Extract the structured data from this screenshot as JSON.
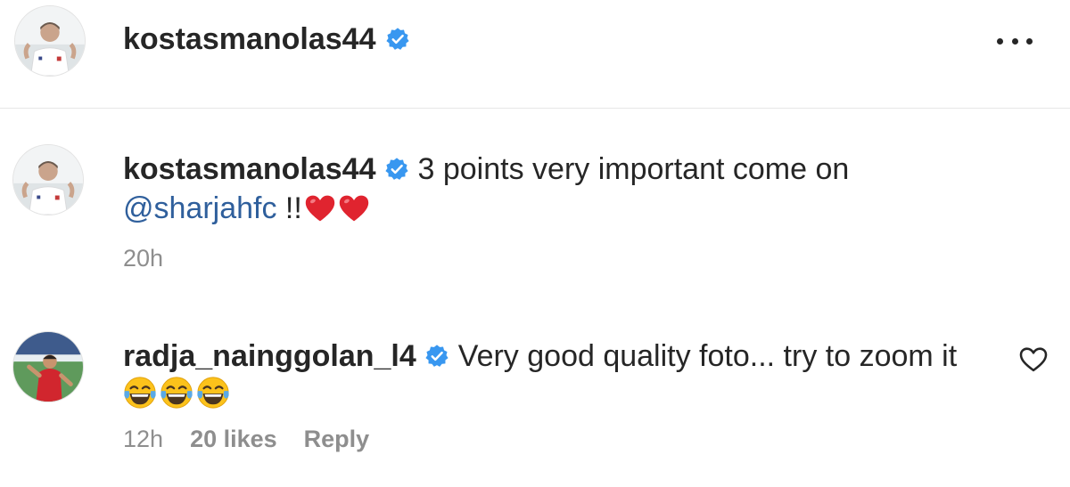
{
  "header": {
    "username": "kostasmanolas44",
    "avatar_icon": "profile-photo-avatar",
    "verified_icon": "verified-badge-icon",
    "more_icon": "more-options-icon"
  },
  "comments": [
    {
      "username": "kostasmanolas44",
      "verified": true,
      "text_line1": "3 points very important come on",
      "mention": "@sharjahfc",
      "text_line2_suffix": " !!",
      "emojis": [
        "heart-emoji",
        "heart-emoji"
      ],
      "time": "20h"
    },
    {
      "username": "radja_nainggolan_l4",
      "verified": true,
      "text_line1": "Very good quality foto... try to zoom it",
      "emojis": [
        "laughing-crying-emoji",
        "laughing-crying-emoji",
        "laughing-crying-emoji"
      ],
      "time": "12h",
      "likes": "20 likes",
      "reply_label": "Reply",
      "like_icon": "heart-outline-icon"
    }
  ],
  "colors": {
    "text": "#262626",
    "muted": "#8e8e8e",
    "link": "#2f5f9c",
    "verified": "#3897f0",
    "heart": "#e0242f",
    "divider": "#e6e6e6"
  }
}
